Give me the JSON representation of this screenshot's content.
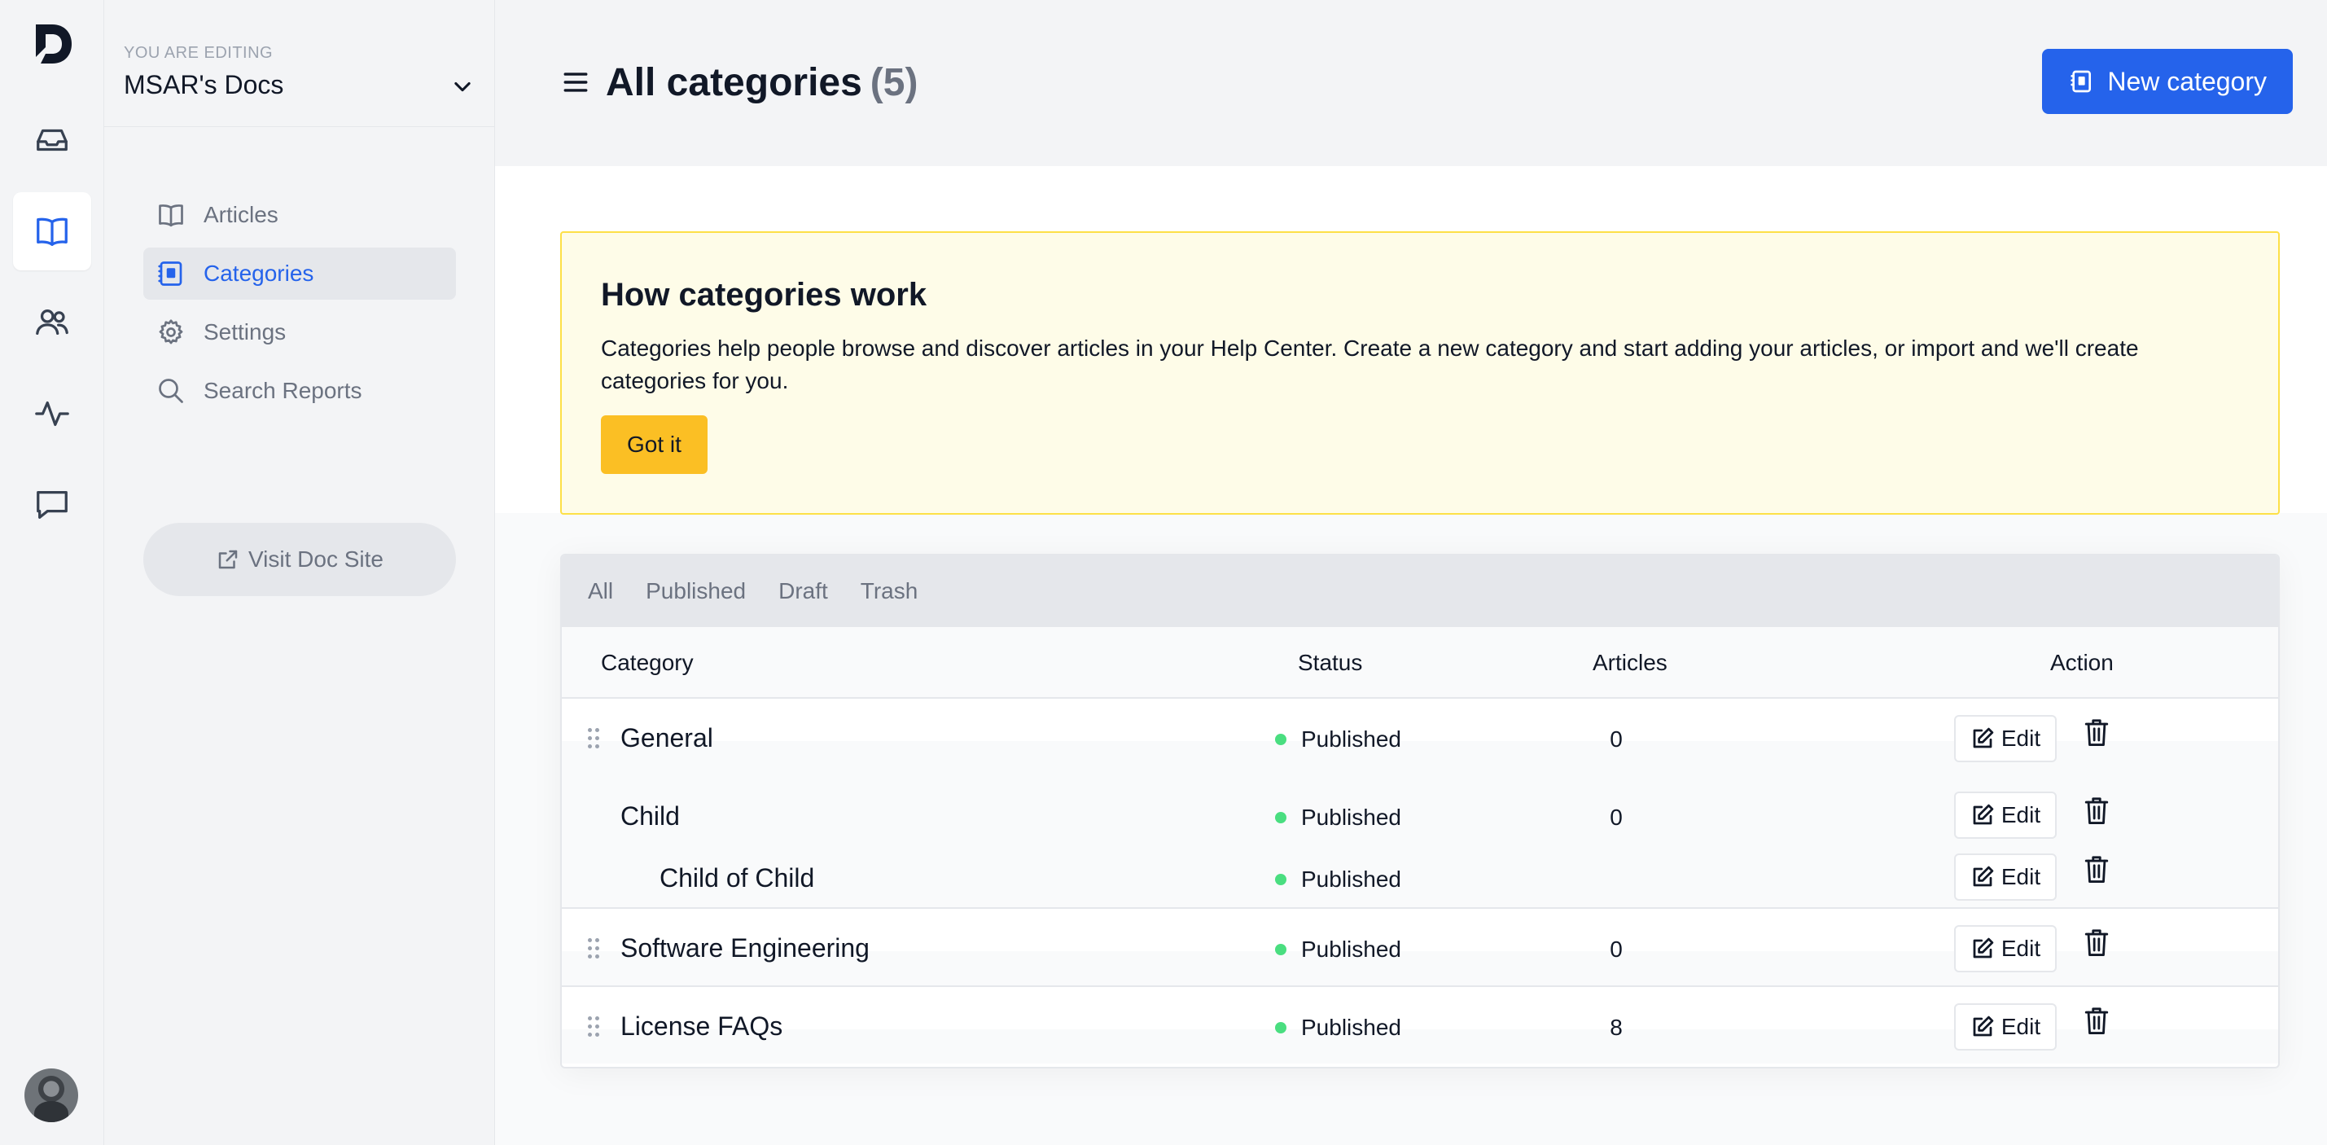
{
  "rail": {
    "items": [
      {
        "name": "inbox-icon"
      },
      {
        "name": "book-icon",
        "active": true
      },
      {
        "name": "users-icon"
      },
      {
        "name": "activity-icon"
      },
      {
        "name": "chat-icon"
      }
    ]
  },
  "workspace": {
    "eyebrow": "YOU ARE EDITING",
    "name": "MSAR's Docs"
  },
  "nav": {
    "items": [
      {
        "label": "Articles",
        "icon": "book-open-icon"
      },
      {
        "label": "Categories",
        "icon": "category-icon",
        "active": true
      },
      {
        "label": "Settings",
        "icon": "gear-icon"
      },
      {
        "label": "Search Reports",
        "icon": "search-icon"
      }
    ],
    "visit_label": "Visit Doc Site"
  },
  "header": {
    "title": "All categories",
    "count": "(5)",
    "new_label": "New category"
  },
  "notice": {
    "title": "How categories work",
    "body": "Categories help people browse and discover articles in your Help Center. Create a new category and start adding your articles, or import and we'll create categories for you.",
    "button": "Got it",
    "accent": "#fbbf24"
  },
  "filters": [
    "All",
    "Published",
    "Draft",
    "Trash"
  ],
  "table": {
    "headers": {
      "category": "Category",
      "status": "Status",
      "articles": "Articles",
      "action": "Action"
    },
    "rows": [
      {
        "name": "General",
        "status": "Published",
        "articles": "0",
        "level": 0
      },
      {
        "name": "Child",
        "status": "Published",
        "articles": "0",
        "level": 1
      },
      {
        "name": "Child of Child",
        "status": "Published",
        "articles": "",
        "level": 2
      },
      {
        "name": "Software Engineering",
        "status": "Published",
        "articles": "0",
        "level": 0
      },
      {
        "name": "License FAQs",
        "status": "Published",
        "articles": "8",
        "level": 0
      }
    ],
    "edit_label": "Edit",
    "status_color": "#4ade80"
  },
  "colors": {
    "primary": "#2563eb",
    "notice_bg": "#fefce8"
  }
}
